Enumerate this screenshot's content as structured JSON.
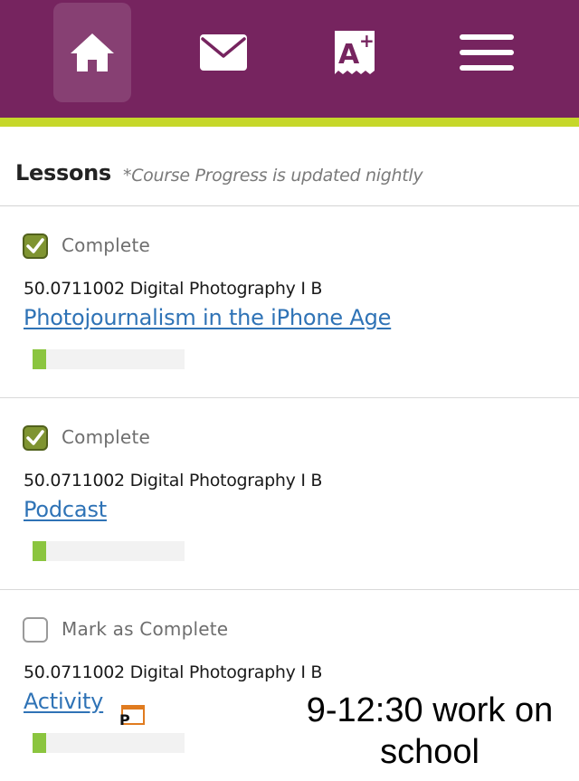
{
  "nav": {
    "items": [
      {
        "name": "home",
        "icon": "home-icon",
        "active": true
      },
      {
        "name": "messages",
        "icon": "mail-icon",
        "active": false
      },
      {
        "name": "grades",
        "icon": "grades-icon",
        "icon_label": "A+",
        "active": false
      },
      {
        "name": "menu",
        "icon": "hamburger-menu-icon",
        "active": false
      }
    ],
    "background_color": "#76245f",
    "accent_color": "#c6d72a"
  },
  "header": {
    "title": "Lessons",
    "note": "*Course Progress is updated nightly"
  },
  "lessons": [
    {
      "checked": true,
      "status": "Complete",
      "course": "50.0711002 Digital Photography I B",
      "title": "Photojournalism in the iPhone Age",
      "progress": 0.09,
      "has_p_icon": false
    },
    {
      "checked": true,
      "status": "Complete",
      "course": "50.0711002 Digital Photography I B",
      "title": "Podcast",
      "progress": 0.09,
      "has_p_icon": false
    },
    {
      "checked": false,
      "status": "Mark as Complete",
      "course": "50.0711002 Digital Photography I B",
      "title": "Activity",
      "progress": 0.09,
      "has_p_icon": true,
      "p_icon_label": "P"
    }
  ],
  "overlay": {
    "line1": "9-12:30 work on",
    "line2": "school"
  },
  "colors": {
    "link": "#2f73b6",
    "checkbox_checked": "#7f9431",
    "progress_fill": "#8bc53f",
    "progress_track": "#f2f2f2"
  }
}
